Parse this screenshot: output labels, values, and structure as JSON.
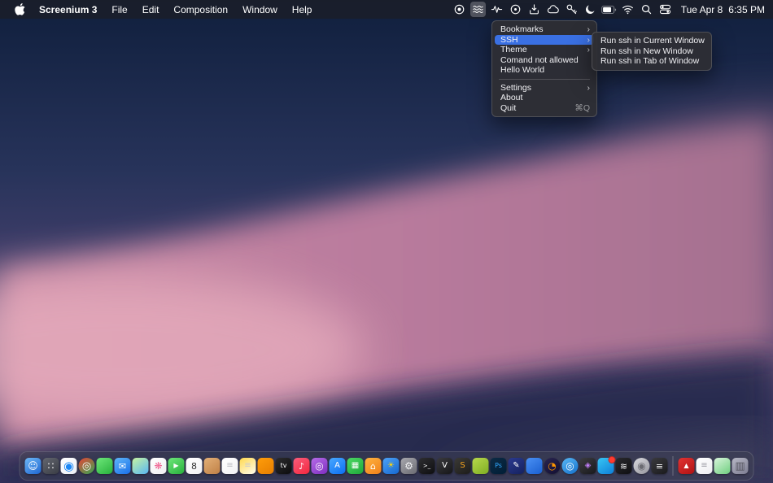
{
  "colors": {
    "accent": "#3a70e3",
    "badge": "#ff3b30"
  },
  "menubar": {
    "app_name": "Screenium 3",
    "menus": [
      "File",
      "Edit",
      "Composition",
      "Window",
      "Help"
    ],
    "status_icons": [
      {
        "name": "screen-record-icon",
        "icon": "record"
      },
      {
        "name": "ssh-menu-waves-icon",
        "icon": "waves",
        "active": true
      },
      {
        "name": "activity-icon",
        "icon": "activity"
      },
      {
        "name": "disc-icon",
        "icon": "disc"
      },
      {
        "name": "import-icon",
        "icon": "import"
      },
      {
        "name": "cloud-icon",
        "icon": "cloud"
      },
      {
        "name": "key-icon",
        "icon": "key"
      },
      {
        "name": "focus-moon-icon",
        "icon": "moon"
      },
      {
        "name": "battery-icon",
        "icon": "battery"
      },
      {
        "name": "wifi-icon",
        "icon": "wifi"
      },
      {
        "name": "spotlight-search-icon",
        "icon": "search"
      },
      {
        "name": "control-center-icon",
        "icon": "control-center"
      }
    ],
    "date": "Tue Apr 8",
    "time": "6:35 PM"
  },
  "dropdown": {
    "items": [
      {
        "label": "Bookmarks",
        "submenu": true
      },
      {
        "label": "SSH",
        "submenu": true,
        "highlighted": true
      },
      {
        "label": "Theme",
        "submenu": true
      },
      {
        "label": "Comand not allowed"
      },
      {
        "label": "Hello World"
      },
      {
        "separator": true
      },
      {
        "label": "Settings",
        "submenu": true
      },
      {
        "label": "About"
      },
      {
        "label": "Quit",
        "shortcut": "⌘Q"
      }
    ]
  },
  "submenu": {
    "parent": "SSH",
    "items": [
      "Run ssh in Current Window",
      "Run ssh in New Window",
      "Run ssh in Tab of Window"
    ]
  },
  "dock": {
    "items": [
      {
        "name": "finder",
        "c1": "#6fb9f7",
        "c2": "#1e66d0",
        "glyph": "☺",
        "gc": "#ffffff",
        "gs": 12
      },
      {
        "name": "launchpad",
        "c1": "#63666f",
        "c2": "#3a3d45",
        "glyph": "∷",
        "gc": "#ffffff",
        "gs": 12
      },
      {
        "name": "safari",
        "c1": "#ffffff",
        "c2": "#e9eef5",
        "glyph": "◉",
        "gc": "#1b87f5",
        "gs": 15
      },
      {
        "name": "chrome",
        "shape": "circle",
        "c1": "#ea4335",
        "c2": "#34a853",
        "glyph": "◎",
        "gc": "#ffffff",
        "gs": 13
      },
      {
        "name": "messages",
        "c1": "#6ee77a",
        "c2": "#28b03c"
      },
      {
        "name": "mail",
        "c1": "#5fb6f9",
        "c2": "#1a6fe8",
        "glyph": "✉",
        "gc": "#ffffff",
        "gs": 11
      },
      {
        "name": "maps",
        "c1": "#c8f3a1",
        "c2": "#58b7f3"
      },
      {
        "name": "photos",
        "c1": "#ffffff",
        "c2": "#efeff2",
        "glyph": "❋",
        "gc": "#f06292",
        "gs": 12
      },
      {
        "name": "facetime",
        "c1": "#6ee77a",
        "c2": "#28b03c",
        "glyph": "▶",
        "gc": "#ffffff",
        "gs": 8
      },
      {
        "name": "calendar",
        "c1": "#ffffff",
        "c2": "#f1f1f4",
        "glyph": "8",
        "gc": "#333333",
        "gs": 11
      },
      {
        "name": "contacts",
        "c1": "#e3b077",
        "c2": "#c08046"
      },
      {
        "name": "reminders",
        "c1": "#ffffff",
        "c2": "#f1f1f4",
        "glyph": "≡",
        "gc": "#b9b9c0",
        "gs": 10
      },
      {
        "name": "notes",
        "c1": "#ffd84d",
        "c2": "#fffdf0",
        "glyph": "≡",
        "gc": "#c9c9ce",
        "gs": 10
      },
      {
        "name": "books",
        "c1": "#ff9d0a",
        "c2": "#e67e00"
      },
      {
        "name": "tv",
        "c1": "#2c2c2e",
        "c2": "#0c0c0d",
        "glyph": "tv",
        "gc": "#ffffff",
        "gs": 8
      },
      {
        "name": "music",
        "c1": "#fb5d7c",
        "c2": "#f2273e",
        "glyph": "♪",
        "gc": "#ffffff",
        "gs": 11
      },
      {
        "name": "podcasts",
        "c1": "#b66ce8",
        "c2": "#7e2ec0",
        "glyph": "◎",
        "gc": "#ffffff",
        "gs": 12
      },
      {
        "name": "app-store",
        "c1": "#4aa9ff",
        "c2": "#0b6ef3",
        "glyph": "A",
        "gc": "#ffffff",
        "gs": 10
      },
      {
        "name": "numbers",
        "c1": "#4cd964",
        "c2": "#1fa83a",
        "glyph": "▦",
        "gc": "#ffffff",
        "gs": 10
      },
      {
        "name": "home",
        "c1": "#ffb340",
        "c2": "#f08019",
        "glyph": "⌂",
        "gc": "#ffffff",
        "gs": 11
      },
      {
        "name": "weather",
        "c1": "#4da2f7",
        "c2": "#1668cf",
        "glyph": "☀",
        "gc": "#ffd60a",
        "gs": 10
      },
      {
        "name": "system-settings",
        "c1": "#a8a8ae",
        "c2": "#6b6b72",
        "glyph": "⚙",
        "gc": "#f2f2f4",
        "gs": 12
      },
      {
        "name": "terminal",
        "c1": "#2e2e31",
        "c2": "#0e0e10",
        "glyph": ">_",
        "gc": "#ffffff",
        "gs": 7
      },
      {
        "name": "video-app",
        "c1": "#3a3a3e",
        "c2": "#161618",
        "glyph": "V",
        "gc": "#ffffff",
        "gs": 10
      },
      {
        "name": "code-editor",
        "c1": "#3b3a36",
        "c2": "#1d1c1a",
        "glyph": "S",
        "gc": "#f7a41d",
        "gs": 10
      },
      {
        "name": "app-green",
        "c1": "#b7d84c",
        "c2": "#7fae23"
      },
      {
        "name": "photoshop",
        "c1": "#0d2b45",
        "c2": "#001e36",
        "glyph": "Ps",
        "gc": "#31a8ff",
        "gs": 8
      },
      {
        "name": "design-app",
        "c1": "#2b3a8f",
        "c2": "#15215e",
        "glyph": "✎",
        "gc": "#ffffff",
        "gs": 10
      },
      {
        "name": "app-blue",
        "c1": "#4a90f4",
        "c2": "#1a5fd0"
      },
      {
        "name": "firefox",
        "shape": "circle",
        "c1": "#2a2550",
        "c2": "#120f33",
        "glyph": "◔",
        "gc": "#ff9500",
        "gs": 12
      },
      {
        "name": "browser",
        "shape": "circle",
        "c1": "#5ab9f5",
        "c2": "#1470cc",
        "glyph": "◎",
        "gc": "#ffffff",
        "gs": 12
      },
      {
        "name": "final-cut",
        "c1": "#3c3c40",
        "c2": "#19191c",
        "glyph": "◈",
        "gc": "#c17ef7",
        "gs": 10
      },
      {
        "name": "chat-app",
        "c1": "#38c6f4",
        "c2": "#0e7fd8",
        "badge": true
      },
      {
        "name": "screenium",
        "c1": "#2a2a2e",
        "c2": "#0f0f12",
        "glyph": "≋",
        "gc": "#ffffff",
        "gs": 11
      },
      {
        "name": "disc-app",
        "shape": "circle",
        "c1": "#d9d9de",
        "c2": "#96969e",
        "glyph": "◉",
        "gc": "#6b6b72",
        "gs": 12
      },
      {
        "name": "lines-app",
        "c1": "#3a3a3e",
        "c2": "#1a1a1d",
        "glyph": "≡",
        "gc": "#ffffff",
        "gs": 11
      },
      {
        "separator": true
      },
      {
        "name": "acrobat",
        "c1": "#e23333",
        "c2": "#b01212",
        "glyph": "▲",
        "gc": "#ffffff",
        "gs": 8
      },
      {
        "name": "textedit",
        "c1": "#ffffff",
        "c2": "#eeeef1",
        "glyph": "≡",
        "gc": "#9a9aa2",
        "gs": 10
      },
      {
        "name": "app-green-white",
        "c1": "#d9f5dc",
        "c2": "#6fcf7f"
      },
      {
        "name": "trash",
        "c1": "#d5d5e0cc",
        "c2": "#9595a8bb",
        "glyph": "▥",
        "gc": "#55555f",
        "gs": 13
      }
    ]
  }
}
